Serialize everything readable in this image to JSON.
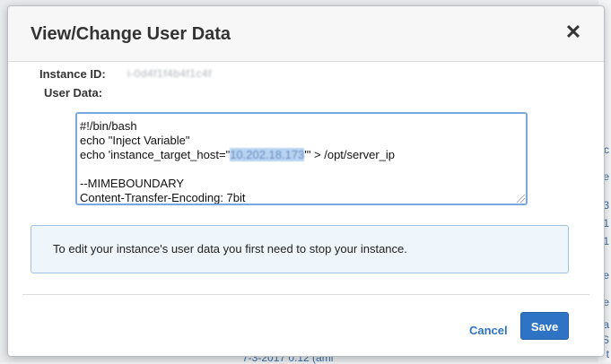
{
  "background": {
    "right_fragments": [
      "c",
      "ve",
      "3",
      "1",
      "1",
      "e",
      "ve",
      "(a",
      "S",
      "t"
    ],
    "bottom_fragment": "7-3-2017 0:12 (ami"
  },
  "modal": {
    "title": "View/Change User Data",
    "close_label": "✕",
    "instance_id_label": "Instance ID:",
    "instance_id_value": "i-0d4f1f4b4f1c4f",
    "user_data_label": "User Data:",
    "user_data_lines": {
      "line1": "#!/bin/bash",
      "line2": "echo \"Inject Variable\"",
      "line3_prefix": "echo 'instance_target_host=\"",
      "line3_ip": "10.202.18.173",
      "line3_suffix": "\"' > /opt/server_ip",
      "line4": "",
      "line5": "--MIMEBOUNDARY",
      "line6": "Content-Transfer-Encoding: 7bit"
    },
    "info_message": "To edit your instance's user data you first need to stop your instance.",
    "cancel_label": "Cancel",
    "save_label": "Save"
  },
  "colors": {
    "primary_button": "#2f73c4",
    "link": "#2d73c2",
    "info_bg": "#eef6fc",
    "info_border": "#9fc3e1",
    "focus_border": "#7aa7e0"
  }
}
